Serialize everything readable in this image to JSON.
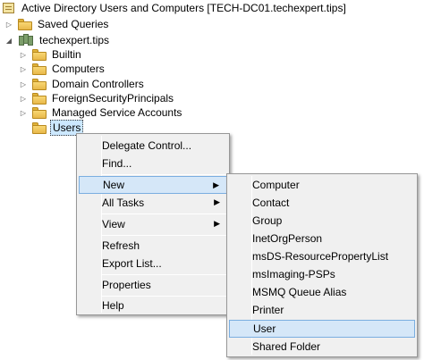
{
  "tree": {
    "root_label": "Active Directory Users and Computers [TECH-DC01.techexpert.tips]",
    "saved_queries": "Saved Queries",
    "domain": "techexpert.tips",
    "children": [
      "Builtin",
      "Computers",
      "Domain Controllers",
      "ForeignSecurityPrincipals",
      "Managed Service Accounts"
    ],
    "selected": "Users"
  },
  "context_menu": {
    "items": [
      "Delegate Control...",
      "Find...",
      "New",
      "All Tasks",
      "View",
      "Refresh",
      "Export List...",
      "Properties",
      "Help"
    ]
  },
  "submenu_new": {
    "items": [
      "Computer",
      "Contact",
      "Group",
      "InetOrgPerson",
      "msDS-ResourcePropertyList",
      "msImaging-PSPs",
      "MSMQ Queue Alias",
      "Printer",
      "User",
      "Shared Folder"
    ]
  },
  "colors": {
    "highlight": "#d5e7f8",
    "highlight_border": "#7aaee0",
    "menu_bg": "#f0f0f0"
  },
  "icons": {
    "folder": "folder-icon",
    "root": "aduc-icon",
    "domain": "domain-icon",
    "submenu": "chevron-right-icon"
  }
}
